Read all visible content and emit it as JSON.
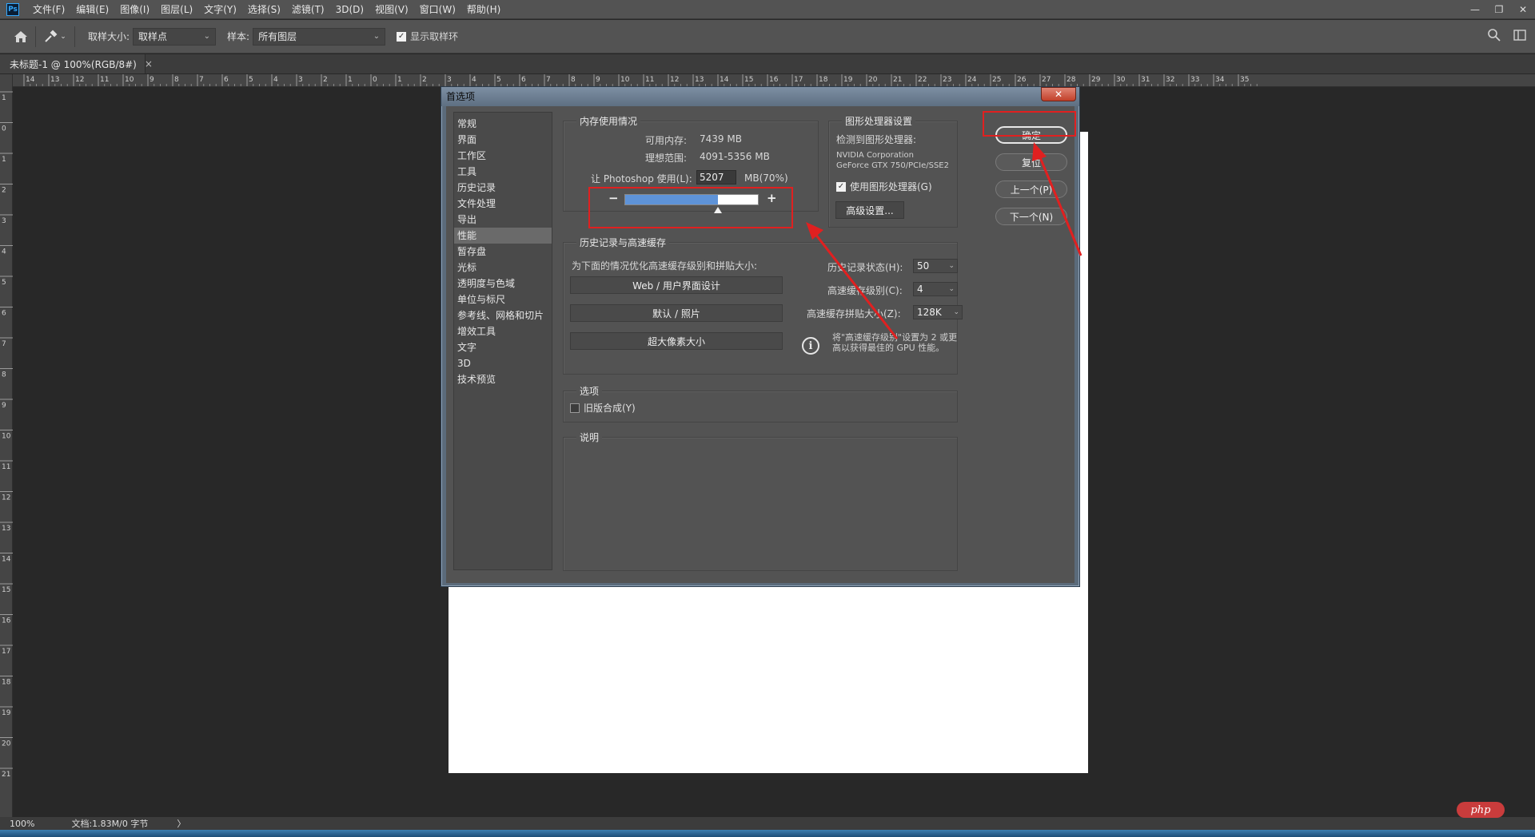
{
  "app": {
    "logo": "Ps"
  },
  "menu": [
    "文件(F)",
    "编辑(E)",
    "图像(I)",
    "图层(L)",
    "文字(Y)",
    "选择(S)",
    "滤镜(T)",
    "3D(D)",
    "视图(V)",
    "窗口(W)",
    "帮助(H)"
  ],
  "window_controls": {
    "minimize": "—",
    "restore": "❐",
    "close": "✕"
  },
  "options_bar": {
    "sample_size_label": "取样大小:",
    "sample_size_value": "取样点",
    "sample_label": "样本:",
    "sample_value": "所有图层",
    "show_ring_label": "显示取样环",
    "show_ring_checked": true
  },
  "document_tab": {
    "title": "未标题-1 @ 100%(RGB/8#)",
    "close": "×"
  },
  "ruler": {
    "h_labels": [
      "14",
      "13",
      "12",
      "11",
      "10",
      "9",
      "8",
      "7",
      "6",
      "5",
      "4",
      "3",
      "2",
      "1",
      "0",
      "1",
      "2",
      "3",
      "4",
      "5",
      "6",
      "7",
      "8",
      "9",
      "10",
      "11",
      "12",
      "13",
      "14",
      "15",
      "16",
      "17",
      "18",
      "19",
      "20",
      "21",
      "22",
      "23",
      "24",
      "25",
      "26",
      "27",
      "28",
      "29",
      "30",
      "31",
      "32",
      "33",
      "34",
      "35"
    ],
    "v_labels": [
      "1",
      "0",
      "1",
      "2",
      "3",
      "4",
      "5",
      "6",
      "7",
      "8",
      "9",
      "10",
      "11",
      "12",
      "13",
      "14",
      "15",
      "16",
      "17",
      "18",
      "19",
      "20",
      "21"
    ]
  },
  "dialog": {
    "title": "首选项",
    "close": "✕",
    "categories": [
      "常规",
      "界面",
      "工作区",
      "工具",
      "历史记录",
      "文件处理",
      "导出",
      "性能",
      "暂存盘",
      "光标",
      "透明度与色域",
      "单位与标尺",
      "参考线、网格和切片",
      "增效工具",
      "文字",
      "3D",
      "技术预览"
    ],
    "active_category": "性能",
    "memory": {
      "title": "内存使用情况",
      "available_label": "可用内存:",
      "available_value": "7439 MB",
      "ideal_label": "理想范围:",
      "ideal_value": "4091-5356 MB",
      "let_label": "让 Photoshop 使用(L):",
      "let_value": "5207",
      "let_unit": "MB(70%)",
      "minus": "−",
      "plus": "+",
      "percent": 0.7
    },
    "gpu": {
      "title": "图形处理器设置",
      "detected_label": "检测到图形处理器:",
      "vendor": "NVIDIA Corporation",
      "model": "GeForce GTX 750/PCIe/SSE2",
      "use_gpu_label": "使用图形处理器(G)",
      "use_gpu_checked": true,
      "advanced_button": "高级设置..."
    },
    "history_cache": {
      "title": "历史记录与高速缓存",
      "optimize_label": "为下面的情况优化高速缓存级别和拼贴大小:",
      "buttons": [
        "Web / 用户界面设计",
        "默认 / 照片",
        "超大像素大小"
      ],
      "history_states_label": "历史记录状态(H):",
      "history_states_value": "50",
      "cache_levels_label": "高速缓存级别(C):",
      "cache_levels_value": "4",
      "cache_tile_label": "高速缓存拼贴大小(Z):",
      "cache_tile_value": "128K",
      "info_icon": "i",
      "info_text_line1": "将\"高速缓存级别\"设置为 2 或更",
      "info_text_line2": "高以获得最佳的 GPU 性能。"
    },
    "options": {
      "title": "选项",
      "legacy_label": "旧版合成(Y)",
      "legacy_checked": false
    },
    "description": {
      "title": "说明"
    },
    "buttons": {
      "ok": "确定",
      "reset": "复位",
      "prev": "上一个(P)",
      "next": "下一个(N)"
    }
  },
  "status": {
    "zoom": "100%",
    "doc_info": "文档:1.83M/0 字节",
    "arrow": "〉"
  },
  "watermark": "php",
  "annotation_color": "#e02020"
}
